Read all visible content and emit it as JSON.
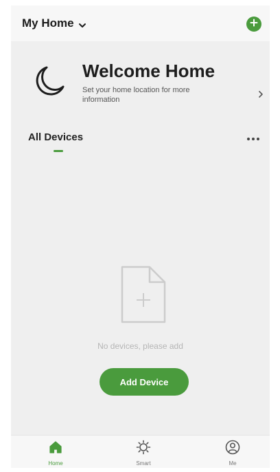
{
  "header": {
    "title": "My Home",
    "dropdown_icon": "chevron-down-icon",
    "add_icon": "plus-circle-icon"
  },
  "welcome": {
    "icon": "moon-icon",
    "title": "Welcome Home",
    "subtitle": "Set your home location for more information",
    "arrow_icon": "chevron-right-icon"
  },
  "devices": {
    "tab_label": "All Devices",
    "more_icon": "more-dots-icon",
    "empty_icon": "add-document-icon",
    "empty_text": "No devices, please add",
    "add_button_label": "Add Device"
  },
  "bottom_nav": {
    "items": [
      {
        "label": "Home",
        "icon": "home-icon",
        "active": true
      },
      {
        "label": "Smart",
        "icon": "sun-icon",
        "active": false
      },
      {
        "label": "Me",
        "icon": "user-icon",
        "active": false
      }
    ]
  },
  "colors": {
    "accent": "#4a9b3d",
    "background": "#efefef",
    "header_background": "#f7f7f7",
    "text_primary": "#1d1d1d",
    "text_muted": "#b5b5b5"
  }
}
